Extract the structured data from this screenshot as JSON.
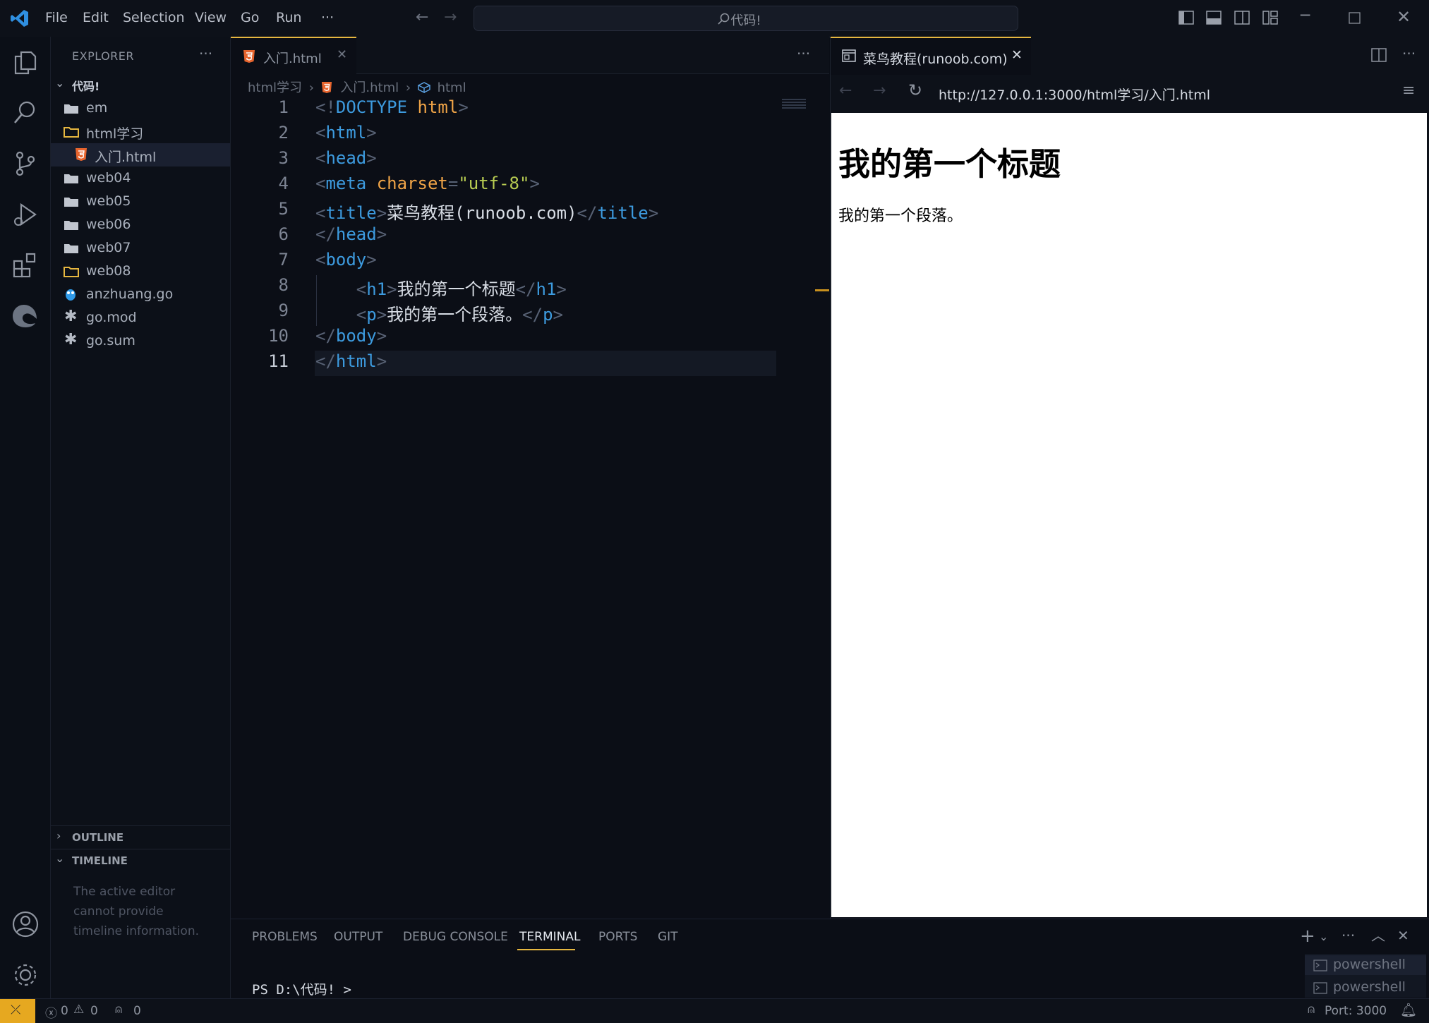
{
  "menu": [
    "File",
    "Edit",
    "Selection",
    "View",
    "Go",
    "Run",
    "···"
  ],
  "search": {
    "placeholder": "代码!"
  },
  "sidebar": {
    "title": "EXPLORER",
    "more": "···",
    "root": "代码!",
    "items": [
      {
        "label": "em",
        "kind": "folder"
      },
      {
        "label": "html学习",
        "kind": "folder-open"
      },
      {
        "label": "入门.html",
        "kind": "html"
      },
      {
        "label": "web04",
        "kind": "folder"
      },
      {
        "label": "web05",
        "kind": "folder"
      },
      {
        "label": "web06",
        "kind": "folder"
      },
      {
        "label": "web07",
        "kind": "folder"
      },
      {
        "label": "web08",
        "kind": "folder-open"
      },
      {
        "label": "anzhuang.go",
        "kind": "go"
      },
      {
        "label": "go.mod",
        "kind": "asterisk"
      },
      {
        "label": "go.sum",
        "kind": "asterisk"
      }
    ],
    "outline": "OUTLINE",
    "timeline": "TIMELINE",
    "timeline_msg": "The active editor cannot provide timeline information."
  },
  "editor": {
    "tab": "入门.html",
    "more": "···",
    "breadcrumb": [
      "html学习",
      "入门.html",
      "html"
    ],
    "lines": [
      [
        [
          "p",
          "<!"
        ],
        [
          "t",
          "DOCTYPE"
        ],
        [
          "x",
          " "
        ],
        [
          "a",
          "html"
        ],
        [
          "p",
          ">"
        ]
      ],
      [
        [
          "p",
          "<"
        ],
        [
          "t",
          "html"
        ],
        [
          "p",
          ">"
        ]
      ],
      [
        [
          "p",
          "<"
        ],
        [
          "t",
          "head"
        ],
        [
          "p",
          ">"
        ]
      ],
      [
        [
          "p",
          "<"
        ],
        [
          "t",
          "meta"
        ],
        [
          "x",
          " "
        ],
        [
          "a",
          "charset"
        ],
        [
          "p",
          "="
        ],
        [
          "s",
          "\"utf-8\""
        ],
        [
          "p",
          ">"
        ]
      ],
      [
        [
          "p",
          "<"
        ],
        [
          "t",
          "title"
        ],
        [
          "p",
          ">"
        ],
        [
          "x",
          "菜鸟教程(runoob.com)"
        ],
        [
          "p",
          "</"
        ],
        [
          "t",
          "title"
        ],
        [
          "p",
          ">"
        ]
      ],
      [
        [
          "p",
          "</"
        ],
        [
          "t",
          "head"
        ],
        [
          "p",
          ">"
        ]
      ],
      [
        [
          "p",
          "<"
        ],
        [
          "t",
          "body"
        ],
        [
          "p",
          ">"
        ]
      ],
      [
        [
          "x",
          "    "
        ],
        [
          "p",
          "<"
        ],
        [
          "t",
          "h1"
        ],
        [
          "p",
          ">"
        ],
        [
          "x",
          "我的第一个标题"
        ],
        [
          "p",
          "</"
        ],
        [
          "t",
          "h1"
        ],
        [
          "p",
          ">"
        ]
      ],
      [
        [
          "x",
          "    "
        ],
        [
          "p",
          "<"
        ],
        [
          "t",
          "p"
        ],
        [
          "p",
          ">"
        ],
        [
          "x",
          "我的第一个段落。"
        ],
        [
          "p",
          "</"
        ],
        [
          "t",
          "p"
        ],
        [
          "p",
          ">"
        ]
      ],
      [
        [
          "p",
          "</"
        ],
        [
          "t",
          "body"
        ],
        [
          "p",
          ">"
        ]
      ],
      [
        [
          "p",
          "</"
        ],
        [
          "t",
          "html"
        ],
        [
          "p",
          ">"
        ]
      ]
    ]
  },
  "browser": {
    "tab": "菜鸟教程(runoob.com)",
    "url": "http://127.0.0.1:3000/html学习/入门.html",
    "h1": "我的第一个标题",
    "p": "我的第一个段落。"
  },
  "panel": {
    "tabs": [
      "PROBLEMS",
      "OUTPUT",
      "DEBUG CONSOLE",
      "TERMINAL",
      "PORTS",
      "GIT"
    ],
    "active": "TERMINAL",
    "prompt": "PS D:\\代码! >",
    "terminals": [
      "powershell",
      "powershell"
    ]
  },
  "status": {
    "errors": "0",
    "warnings": "0",
    "ports": "0",
    "port_label": "Port: 3000"
  }
}
